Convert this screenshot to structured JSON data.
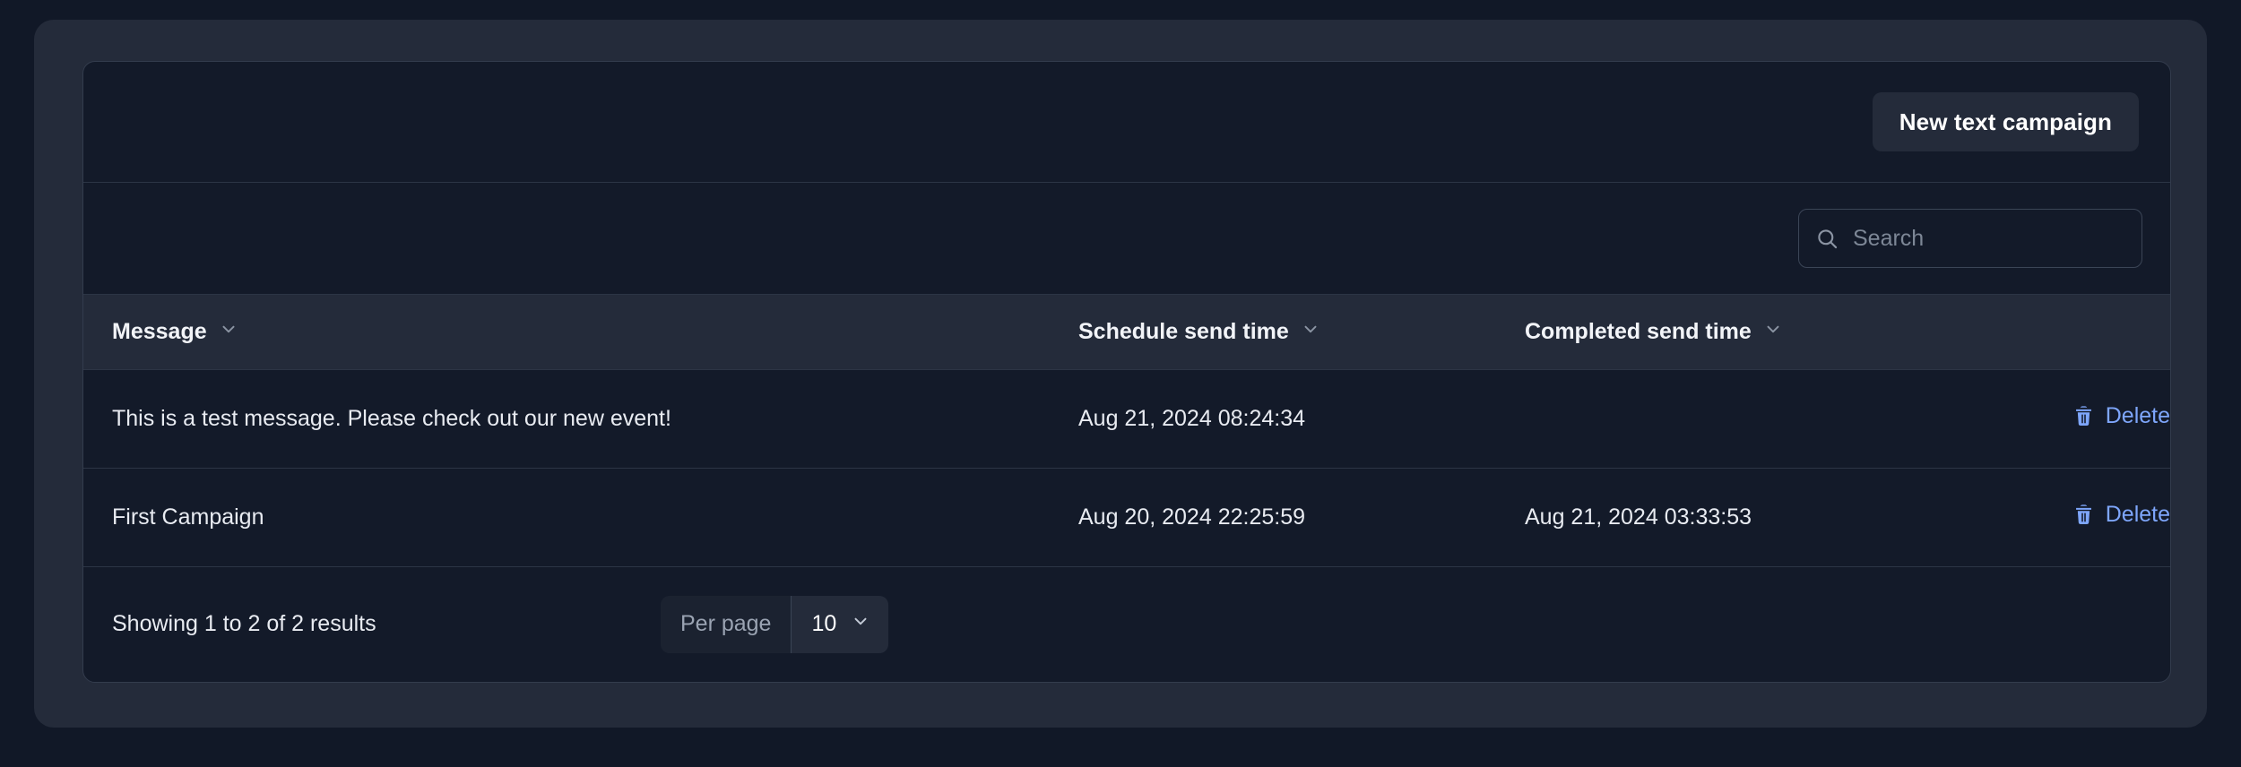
{
  "toolbar": {
    "new_campaign_label": "New text campaign"
  },
  "search": {
    "placeholder": "Search",
    "value": ""
  },
  "table": {
    "columns": [
      {
        "label": "Message",
        "sort_icon": "chevron-down-icon"
      },
      {
        "label": "Schedule send time",
        "sort_icon": "chevron-down-icon"
      },
      {
        "label": "Completed send time",
        "sort_icon": "chevron-down-icon"
      },
      {
        "label": ""
      }
    ],
    "rows": [
      {
        "message": "This is a test message. Please check out our new event!",
        "schedule_send_time": "Aug 21, 2024 08:24:34",
        "completed_send_time": "",
        "action_label": "Delete",
        "action_icon": "trash-icon"
      },
      {
        "message": "First Campaign",
        "schedule_send_time": "Aug 20, 2024 22:25:59",
        "completed_send_time": "Aug 21, 2024 03:33:53",
        "action_label": "Delete",
        "action_icon": "trash-icon"
      }
    ]
  },
  "footer": {
    "results_text": "Showing 1 to 2 of 2 results",
    "per_page_label": "Per page",
    "per_page_value": "10",
    "per_page_options": [
      "10"
    ]
  },
  "colors": {
    "page_background": "#111827",
    "panel_background": "#242b3a",
    "card_background": "#131a29",
    "border": "#2c3545",
    "accent_link": "#7ea6fb",
    "text_primary": "#e8ebf1",
    "text_muted": "#7d8796"
  }
}
